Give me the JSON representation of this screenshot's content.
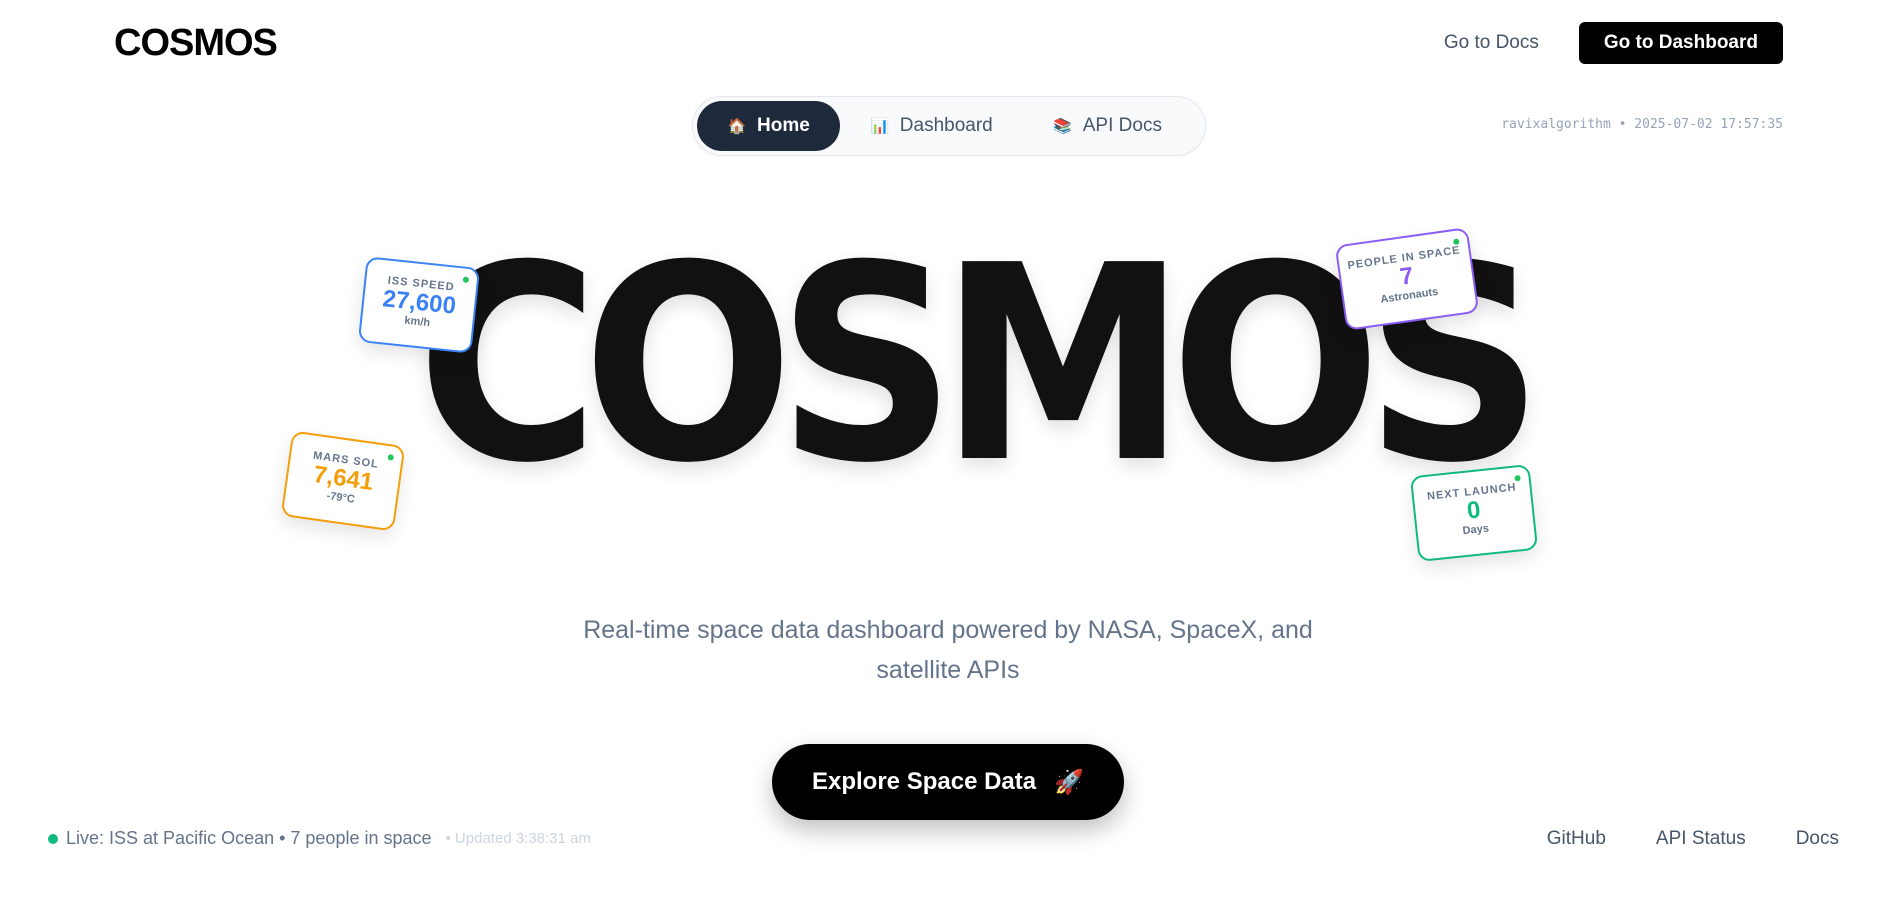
{
  "header": {
    "brand": "COSMOS",
    "docs_link": "Go to Docs",
    "dashboard_button": "Go to Dashboard"
  },
  "nav": {
    "items": [
      {
        "icon": "🏠",
        "label": "Home",
        "active": true
      },
      {
        "icon": "📊",
        "label": "Dashboard",
        "active": false
      },
      {
        "icon": "📚",
        "label": "API Docs",
        "active": false
      }
    ]
  },
  "meta": "ravixalgorithm • 2025-07-02 17:57:35",
  "hero": {
    "word": "COSMOS",
    "tagline": "Real-time space data dashboard powered by NASA, SpaceX, and satellite APIs",
    "cta": "Explore Space Data",
    "cta_icon": "🚀"
  },
  "cards": {
    "iss": {
      "label": "ISS SPEED",
      "value": "27,600",
      "unit": "km/h"
    },
    "mars": {
      "label": "MARS SOL",
      "value": "7,641",
      "unit": "-79°C"
    },
    "people": {
      "label": "PEOPLE IN SPACE",
      "value": "7",
      "unit": "Astronauts"
    },
    "launch": {
      "label": "NEXT LAUNCH",
      "value": "0",
      "unit": "Days"
    }
  },
  "status": {
    "text": "Live: ISS at Pacific Ocean • 7 people in space",
    "updated": "• Updated 3:38:31 am"
  },
  "footer": {
    "github": "GitHub",
    "api_status": "API Status",
    "docs": "Docs"
  },
  "colors": {
    "accent_dark": "#1e293b",
    "iss": "#3b82f6",
    "mars": "#f59e0b",
    "people": "#8b5cf6",
    "launch": "#10b981",
    "live": "#10b981"
  }
}
